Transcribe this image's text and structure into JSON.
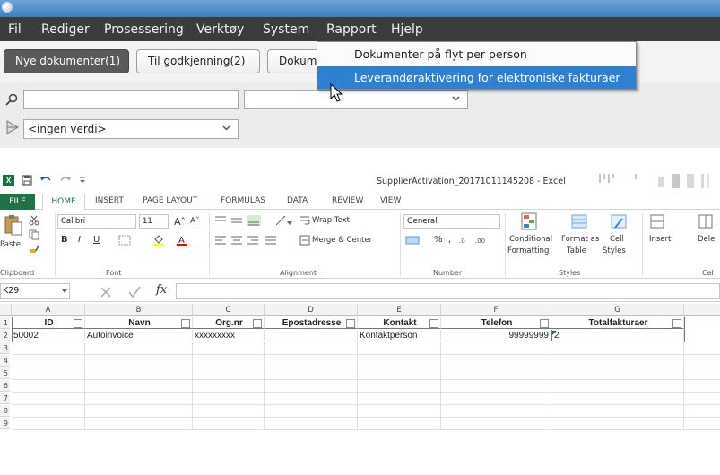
{
  "app": {
    "menu": [
      "Fil",
      "Rediger",
      "Prosessering",
      "Verktøy",
      "System",
      "Rapport",
      "Hjelp"
    ],
    "tabs": [
      "Nye dokumenter(1)",
      "Til godkjenning(2)",
      "Dokum"
    ],
    "filter_value": "<ingen verdi>",
    "popup_items": [
      "Dokumenter på flyt per person",
      "Leverandøraktivering for elektroniske fakturaer"
    ]
  },
  "excel": {
    "window_title": "SupplierActivation_20171011145208 - Excel",
    "ribbon_tabs": [
      "FILE",
      "HOME",
      "INSERT",
      "PAGE LAYOUT",
      "FORMULAS",
      "DATA",
      "REVIEW",
      "VIEW"
    ],
    "clipboard": {
      "paste": "Paste",
      "label": "Clipboard"
    },
    "font": {
      "name": "Calibri",
      "size": "11",
      "label": "Font",
      "bold": "B",
      "italic": "I",
      "underline": "U"
    },
    "alignment": {
      "wrap": "Wrap Text",
      "merge": "Merge & Center",
      "label": "Alignment"
    },
    "number": {
      "format": "General",
      "percent": "%",
      "comma": ",",
      "label": "Number"
    },
    "styles": {
      "conditional": [
        "Conditional",
        "Formatting"
      ],
      "format_table": [
        "Format as",
        "Table"
      ],
      "cell_styles": [
        "Cell",
        "Styles"
      ],
      "label": "Styles"
    },
    "cells": {
      "insert": "Insert",
      "delete": "Dele",
      "label": "Cel"
    },
    "name_box": "K29",
    "fx": "fx",
    "columns": [
      "A",
      "B",
      "C",
      "D",
      "E",
      "F",
      "G"
    ],
    "rows": [
      "1",
      "2",
      "3",
      "4",
      "5",
      "6",
      "7",
      "8",
      "9"
    ],
    "headers": [
      "ID",
      "Navn",
      "Org.nr",
      "Epostadresse",
      "Kontakt",
      "Telefon",
      "Totalfakturaer"
    ],
    "data_row": [
      "50002",
      "Autoinvoice",
      "xxxxxxxxx",
      "",
      "Kontaktperson",
      "99999999",
      "2"
    ]
  },
  "colors": {
    "excel_green": "#217346",
    "highlight": "#2f80d0",
    "menubar": "#3c3c3c"
  }
}
